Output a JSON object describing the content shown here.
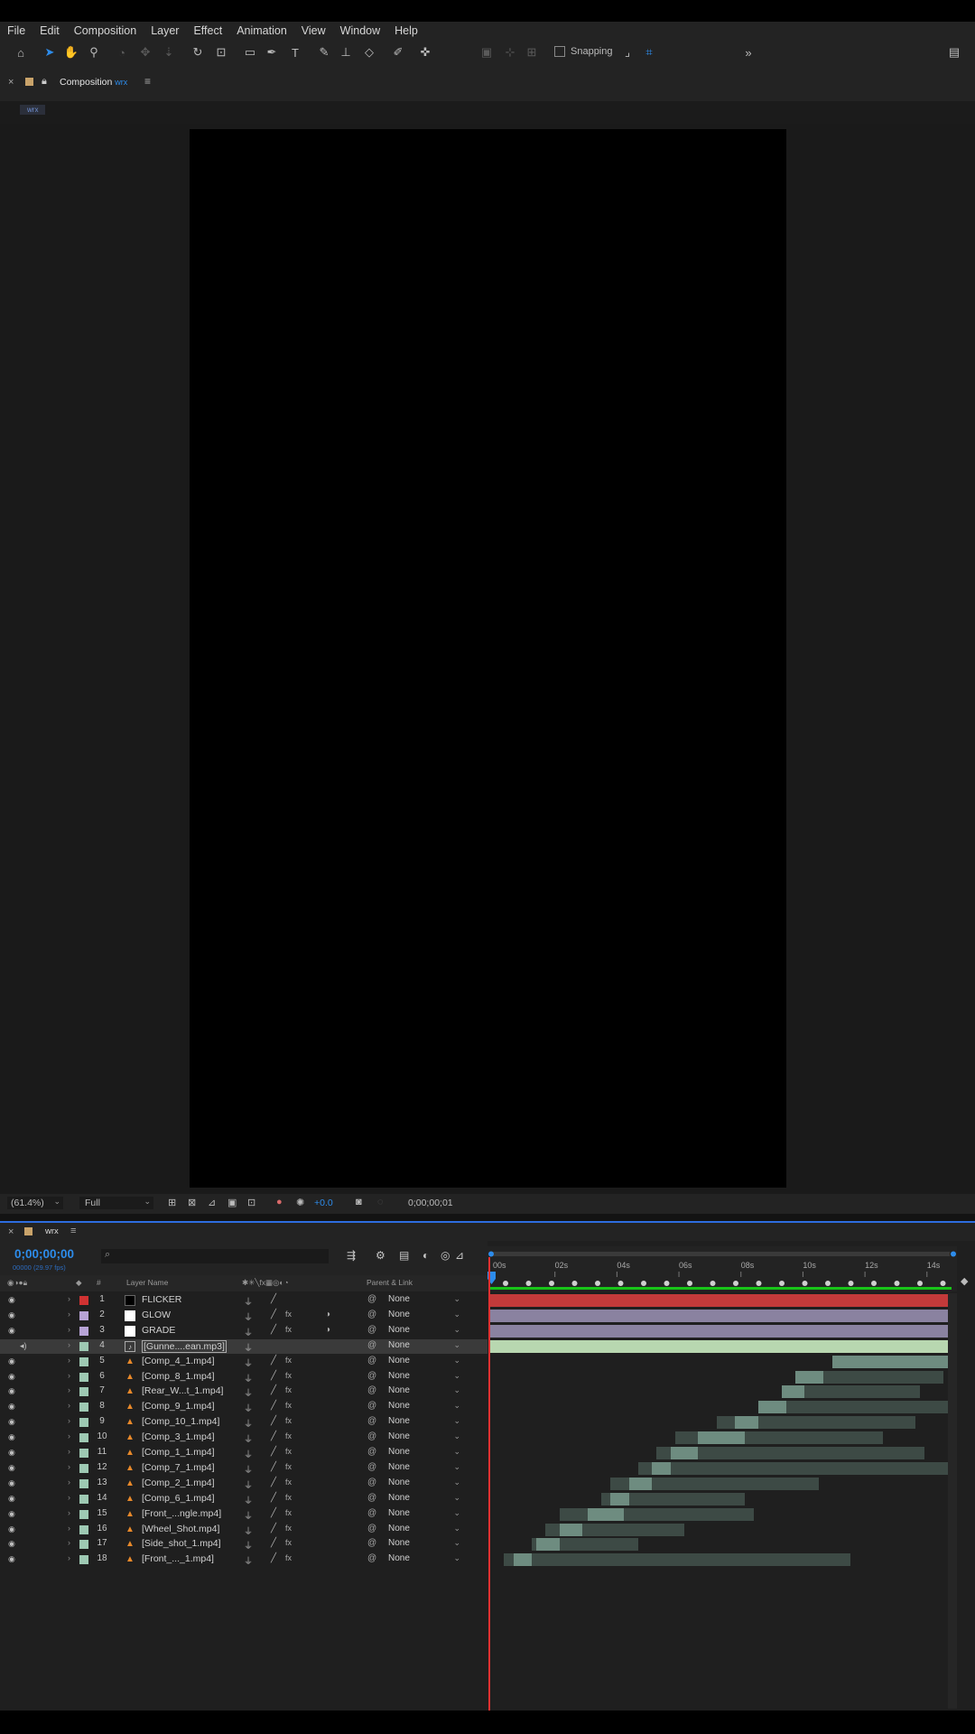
{
  "menu": [
    "File",
    "Edit",
    "Composition",
    "Layer",
    "Effect",
    "Animation",
    "View",
    "Window",
    "Help"
  ],
  "toolbar": {
    "snapping_label": "Snapping",
    "expand_glyph": "»"
  },
  "composition_panel": {
    "close_glyph": "×",
    "panel_label": "Composition",
    "comp_name": "wrx",
    "menu_glyph": "≡",
    "tab_label": "wrx"
  },
  "viewer_bar": {
    "zoom": "(61.4%)",
    "resolution": "Full",
    "exposure": "+0.0",
    "timecode": "0;00;00;01"
  },
  "timeline": {
    "tab_label": "wrx",
    "current_time": "0;00;00;00",
    "fps_info": "00000 (29.97 fps)",
    "search_glyph": "⌕",
    "columns": {
      "hash": "#",
      "layer_name": "Layer Name",
      "parent": "Parent & Link"
    },
    "ruler_ticks": [
      "00s",
      "02s",
      "04s",
      "06s",
      "08s",
      "10s",
      "12s",
      "14s"
    ],
    "layers": [
      {
        "num": "1",
        "name": "FLICKER",
        "label_color": "#d03232",
        "src": "solid-black",
        "parent": "None",
        "fx": false,
        "mb": false
      },
      {
        "num": "2",
        "name": "GLOW",
        "label_color": "#b7a3d6",
        "src": "solid-white",
        "parent": "None",
        "fx": true,
        "mb": true
      },
      {
        "num": "3",
        "name": "GRADE",
        "label_color": "#b7a3d6",
        "src": "solid-white",
        "parent": "None",
        "fx": true,
        "mb": true
      },
      {
        "num": "4",
        "name": "[Gunne....ean.mp3]",
        "label_color": "#9ec9b3",
        "src": "audio",
        "parent": "None",
        "fx": false,
        "mb": false,
        "selected": true
      },
      {
        "num": "5",
        "name": "[Comp_4_1.mp4]",
        "label_color": "#9ec9b3",
        "src": "video",
        "parent": "None",
        "fx": true,
        "mb": false
      },
      {
        "num": "6",
        "name": "[Comp_8_1.mp4]",
        "label_color": "#9ec9b3",
        "src": "video",
        "parent": "None",
        "fx": true,
        "mb": false
      },
      {
        "num": "7",
        "name": "[Rear_W...t_1.mp4]",
        "label_color": "#9ec9b3",
        "src": "video",
        "parent": "None",
        "fx": true,
        "mb": false
      },
      {
        "num": "8",
        "name": "[Comp_9_1.mp4]",
        "label_color": "#9ec9b3",
        "src": "video",
        "parent": "None",
        "fx": true,
        "mb": false
      },
      {
        "num": "9",
        "name": "[Comp_10_1.mp4]",
        "label_color": "#9ec9b3",
        "src": "video",
        "parent": "None",
        "fx": true,
        "mb": false
      },
      {
        "num": "10",
        "name": "[Comp_3_1.mp4]",
        "label_color": "#9ec9b3",
        "src": "video",
        "parent": "None",
        "fx": true,
        "mb": false
      },
      {
        "num": "11",
        "name": "[Comp_1_1.mp4]",
        "label_color": "#9ec9b3",
        "src": "video",
        "parent": "None",
        "fx": true,
        "mb": false
      },
      {
        "num": "12",
        "name": "[Comp_7_1.mp4]",
        "label_color": "#9ec9b3",
        "src": "video",
        "parent": "None",
        "fx": true,
        "mb": false
      },
      {
        "num": "13",
        "name": "[Comp_2_1.mp4]",
        "label_color": "#9ec9b3",
        "src": "video",
        "parent": "None",
        "fx": true,
        "mb": false
      },
      {
        "num": "14",
        "name": "[Comp_6_1.mp4]",
        "label_color": "#9ec9b3",
        "src": "video",
        "parent": "None",
        "fx": true,
        "mb": false
      },
      {
        "num": "15",
        "name": "[Front_...ngle.mp4]",
        "label_color": "#9ec9b3",
        "src": "video",
        "parent": "None",
        "fx": true,
        "mb": false
      },
      {
        "num": "16",
        "name": "[Wheel_Shot.mp4]",
        "label_color": "#9ec9b3",
        "src": "video",
        "parent": "None",
        "fx": true,
        "mb": false
      },
      {
        "num": "17",
        "name": "[Side_shot_1.mp4]",
        "label_color": "#9ec9b3",
        "src": "video",
        "parent": "None",
        "fx": true,
        "mb": false
      },
      {
        "num": "18",
        "name": "[Front_..._1.mp4]",
        "label_color": "#9ec9b3",
        "src": "video",
        "parent": "None",
        "fx": true,
        "mb": false
      }
    ],
    "layer_bars": [
      {
        "start": 0.0,
        "end": 1.0,
        "color": "#c23a3a",
        "hi_start": 0.0,
        "hi_end": 0.0
      },
      {
        "start": 0.0,
        "end": 1.0,
        "color": "#8a82a0",
        "hi_start": 0.0,
        "hi_end": 0.0
      },
      {
        "start": 0.0,
        "end": 1.0,
        "color": "#8a82a0",
        "hi_start": 0.0,
        "hi_end": 0.0
      },
      {
        "start": 0.0,
        "end": 1.0,
        "color": "#b8d7b0",
        "hi_start": 0.0,
        "hi_end": 0.0
      },
      {
        "start": 0.74,
        "end": 1.0,
        "color": "#3d4a45",
        "hi_start": 0.74,
        "hi_end": 1.0
      },
      {
        "start": 0.66,
        "end": 0.98,
        "color": "#3d4a45",
        "hi_start": 0.66,
        "hi_end": 0.72
      },
      {
        "start": 0.63,
        "end": 0.93,
        "color": "#3d4a45",
        "hi_start": 0.63,
        "hi_end": 0.68
      },
      {
        "start": 0.58,
        "end": 1.0,
        "color": "#3d4a45",
        "hi_start": 0.58,
        "hi_end": 0.64
      },
      {
        "start": 0.49,
        "end": 0.92,
        "color": "#3d4a45",
        "hi_start": 0.53,
        "hi_end": 0.58
      },
      {
        "start": 0.4,
        "end": 0.85,
        "color": "#3d4a45",
        "hi_start": 0.45,
        "hi_end": 0.55
      },
      {
        "start": 0.36,
        "end": 0.94,
        "color": "#3d4a45",
        "hi_start": 0.39,
        "hi_end": 0.45
      },
      {
        "start": 0.32,
        "end": 1.0,
        "color": "#3d4a45",
        "hi_start": 0.35,
        "hi_end": 0.39
      },
      {
        "start": 0.26,
        "end": 0.71,
        "color": "#3d4a45",
        "hi_start": 0.3,
        "hi_end": 0.35
      },
      {
        "start": 0.24,
        "end": 0.55,
        "color": "#3d4a45",
        "hi_start": 0.26,
        "hi_end": 0.3
      },
      {
        "start": 0.15,
        "end": 0.57,
        "color": "#3d4a45",
        "hi_start": 0.21,
        "hi_end": 0.29
      },
      {
        "start": 0.12,
        "end": 0.42,
        "color": "#3d4a45",
        "hi_start": 0.15,
        "hi_end": 0.2
      },
      {
        "start": 0.09,
        "end": 0.32,
        "color": "#3d4a45",
        "hi_start": 0.1,
        "hi_end": 0.15
      },
      {
        "start": 0.03,
        "end": 0.78,
        "color": "#3d4a45",
        "hi_start": 0.05,
        "hi_end": 0.09
      }
    ],
    "work_area_color": "#18c418",
    "playhead_color": "#e03030",
    "accent_color": "#2d8ceb"
  }
}
